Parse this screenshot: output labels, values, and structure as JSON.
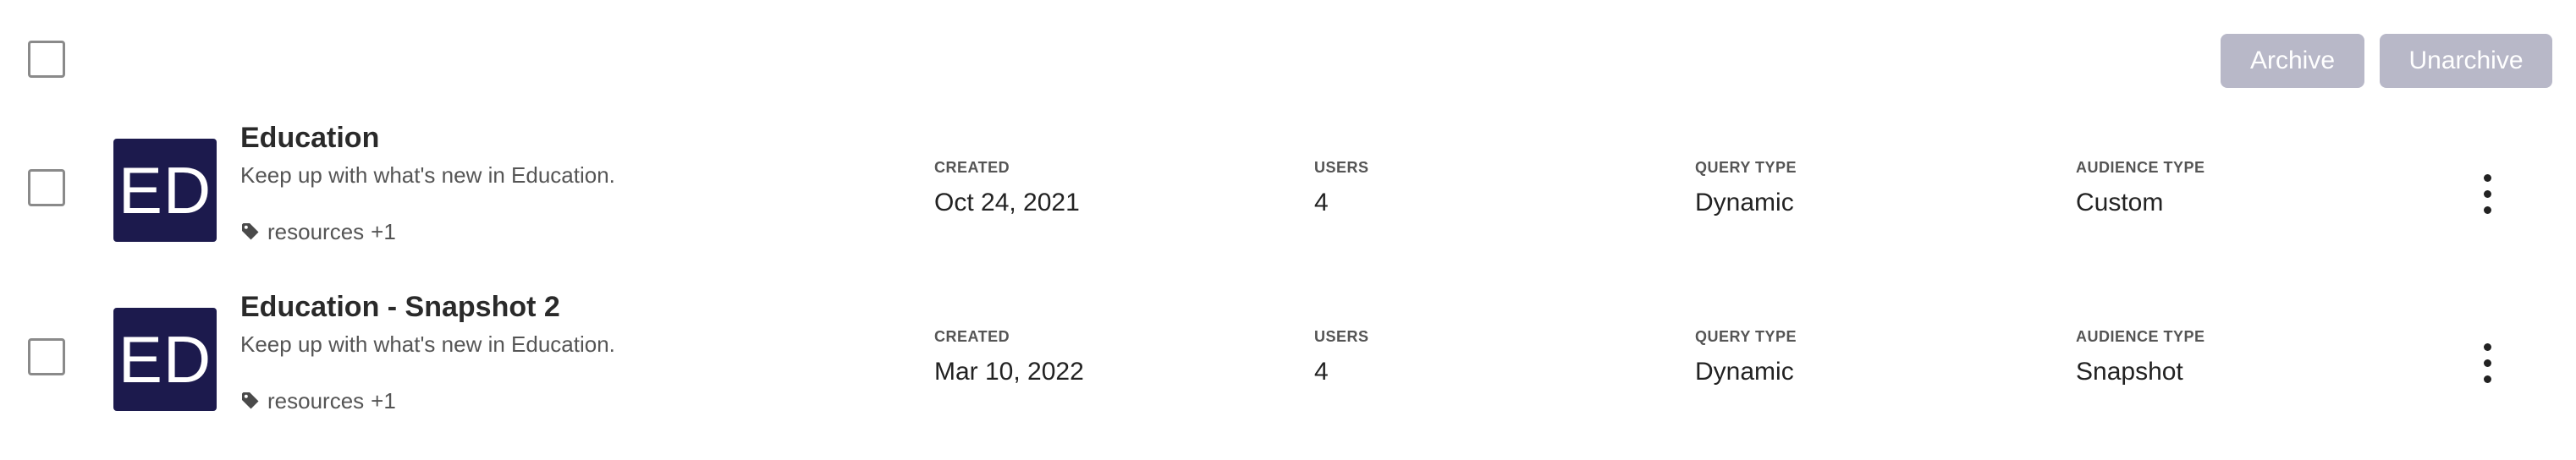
{
  "toolbar": {
    "archive_label": "Archive",
    "unarchive_label": "Unarchive"
  },
  "rows": [
    {
      "avatar_initials": "ED",
      "title": "Education",
      "description": "Keep up with what's new in Education.",
      "tag_icon": "tag-icon",
      "tag": "resources",
      "tag_more": "+1",
      "created_label": "CREATED",
      "created": "Oct 24, 2021",
      "users_label": "USERS",
      "users": "4",
      "query_type_label": "QUERY TYPE",
      "query_type": "Dynamic",
      "audience_type_label": "AUDIENCE TYPE",
      "audience_type": "Custom"
    },
    {
      "avatar_initials": "ED",
      "title": "Education - Snapshot 2",
      "description": "Keep up with what's new in Education.",
      "tag_icon": "tag-icon",
      "tag": "resources",
      "tag_more": "+1",
      "created_label": "CREATED",
      "created": "Mar 10, 2022",
      "users_label": "USERS",
      "users": "4",
      "query_type_label": "QUERY TYPE",
      "query_type": "Dynamic",
      "audience_type_label": "AUDIENCE TYPE",
      "audience_type": "Snapshot"
    }
  ],
  "colors": {
    "avatar_bg": "#1c1a4d",
    "button_disabled_bg": "#b8b8c8",
    "text_primary": "#222222",
    "text_secondary": "#555555"
  }
}
